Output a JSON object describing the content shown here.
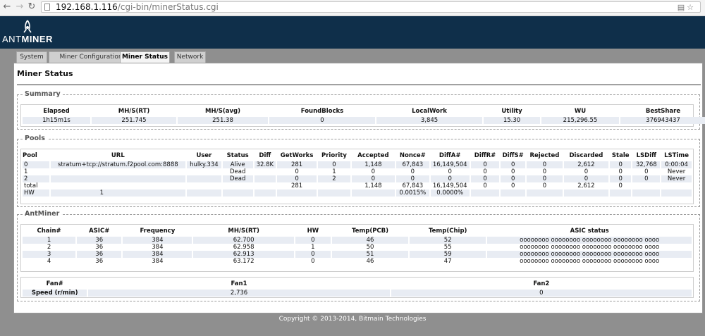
{
  "browser": {
    "url_host": "192.168.1.116",
    "url_path": "/cgi-bin/minerStatus.cgi"
  },
  "logo": {
    "prefix": "ANT",
    "suffix": "MINER"
  },
  "tabs": [
    "System",
    "Miner Configuration",
    "Miner Status",
    "Network"
  ],
  "page_title": "Miner Status",
  "summary": {
    "legend": "Summary",
    "headers": [
      "Elapsed",
      "MH/S(RT)",
      "MH/S(avg)",
      "FoundBlocks",
      "LocalWork",
      "Utility",
      "WU",
      "BestShare"
    ],
    "values": [
      "1h15m1s",
      "251.745",
      "251.38",
      "0",
      "3,845",
      "15.30",
      "215,296.55",
      "376943437"
    ]
  },
  "pools": {
    "legend": "Pools",
    "headers": [
      "Pool",
      "URL",
      "User",
      "Status",
      "Diff",
      "GetWorks",
      "Priority",
      "Accepted",
      "Nonce#",
      "DiffA#",
      "DiffR#",
      "DiffS#",
      "Rejected",
      "Discarded",
      "Stale",
      "LSDiff",
      "LSTime"
    ],
    "rows": [
      [
        "0",
        "stratum+tcp://stratum.f2pool.com:8888",
        "hulky.334",
        "Alive",
        "32.8K",
        "281",
        "0",
        "1,148",
        "67,843",
        "16,149,504",
        "0",
        "0",
        "0",
        "2,612",
        "0",
        "32,768",
        "0:00:04"
      ],
      [
        "1",
        "",
        "",
        "Dead",
        "",
        "0",
        "1",
        "0",
        "0",
        "0",
        "0",
        "0",
        "0",
        "0",
        "0",
        "0",
        "Never"
      ],
      [
        "2",
        "",
        "",
        "Dead",
        "",
        "0",
        "2",
        "0",
        "0",
        "0",
        "0",
        "0",
        "0",
        "0",
        "0",
        "0",
        "Never"
      ],
      [
        "total",
        "",
        "",
        "",
        "",
        "281",
        "",
        "1,148",
        "67,843",
        "16,149,504",
        "0",
        "0",
        "0",
        "2,612",
        "0",
        "",
        ""
      ],
      [
        "HW",
        "1",
        "",
        "",
        "",
        "",
        "",
        "",
        "0.0015%",
        "0.0000%",
        "",
        "",
        "",
        "",
        "",
        "",
        ""
      ]
    ]
  },
  "antminer": {
    "legend": "AntMiner",
    "headers": [
      "Chain#",
      "ASIC#",
      "Frequency",
      "MH/S(RT)",
      "HW",
      "Temp(PCB)",
      "Temp(Chip)",
      "ASIC status"
    ],
    "rows": [
      [
        "1",
        "36",
        "384",
        "62.700",
        "0",
        "46",
        "52",
        "oooooooo oooooooo oooooooo oooooooo oooo"
      ],
      [
        "2",
        "36",
        "384",
        "62.958",
        "1",
        "50",
        "55",
        "oooooooo oooooooo oooooooo oooooooo oooo"
      ],
      [
        "3",
        "36",
        "384",
        "62.913",
        "0",
        "51",
        "59",
        "oooooooo oooooooo oooooooo oooooooo oooo"
      ],
      [
        "4",
        "36",
        "384",
        "63.172",
        "0",
        "46",
        "47",
        "oooooooo oooooooo oooooooo oooooooo oooo"
      ]
    ],
    "fans": {
      "headers": [
        "Fan#",
        "Fan1",
        "Fan2"
      ],
      "label": "Speed (r/min)",
      "values": [
        "2,736",
        "0"
      ]
    }
  },
  "footer": "Copyright © 2013-2014, Bitmain Technologies"
}
